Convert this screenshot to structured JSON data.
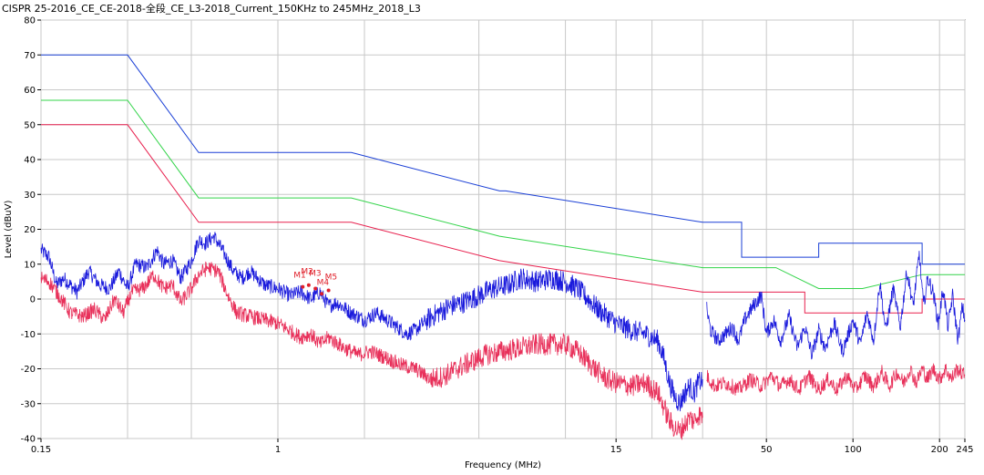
{
  "title": "CISPR 25-2016_CE_CE-2018-全段_CE_L3-2018_Current_150KHz to 245MHz_2018_L3",
  "chart_data": {
    "type": "line",
    "title": "CISPR 25-2016_CE_CE-2018-全段_CE_L3-2018_Current_150KHz to 245MHz_2018_L3",
    "xlabel": "Frequency (MHz)",
    "ylabel": "Level (dBuV)",
    "xscale": "log",
    "xlim": [
      0.15,
      245
    ],
    "ylim": [
      -40,
      80
    ],
    "grid": true,
    "x_ticks": [
      {
        "value": 0.15,
        "label": "0.15"
      },
      {
        "value": 1,
        "label": "1"
      },
      {
        "value": 15,
        "label": "15"
      },
      {
        "value": 50,
        "label": "50"
      },
      {
        "value": 100,
        "label": "100"
      },
      {
        "value": 200,
        "label": "200"
      },
      {
        "value": 245,
        "label": "245"
      }
    ],
    "x_grid": [
      0.15,
      0.3,
      0.5,
      1,
      2,
      5,
      10,
      15,
      20,
      30,
      50,
      100,
      200,
      245
    ],
    "y_ticks": [
      -40,
      -30,
      -20,
      -10,
      0,
      10,
      20,
      30,
      40,
      50,
      60,
      70,
      80
    ],
    "series": [
      {
        "kind": "limit",
        "color": "#1a3fd6",
        "points": [
          [
            0.15,
            70
          ],
          [
            0.3,
            70
          ],
          [
            0.53,
            42
          ],
          [
            1.8,
            42
          ],
          [
            5.9,
            31
          ],
          [
            6.2,
            31
          ],
          [
            30,
            22
          ],
          [
            41,
            22
          ],
          [
            41,
            12
          ],
          [
            54,
            12
          ],
          [
            54,
            12
          ],
          [
            76,
            12
          ],
          [
            76,
            16
          ],
          [
            174,
            16
          ],
          [
            174,
            10
          ],
          [
            245,
            10
          ]
        ]
      },
      {
        "kind": "limit",
        "color": "#33d44a",
        "points": [
          [
            0.15,
            57
          ],
          [
            0.3,
            57
          ],
          [
            0.53,
            29
          ],
          [
            1.8,
            29
          ],
          [
            5.9,
            18
          ],
          [
            30,
            9
          ],
          [
            54,
            9
          ],
          [
            76,
            3
          ],
          [
            108,
            3
          ],
          [
            174,
            7
          ],
          [
            174,
            7
          ],
          [
            245,
            7
          ]
        ]
      },
      {
        "kind": "limit",
        "color": "#e8204e",
        "points": [
          [
            0.15,
            50
          ],
          [
            0.3,
            50
          ],
          [
            0.53,
            22
          ],
          [
            1.8,
            22
          ],
          [
            5.9,
            11
          ],
          [
            30,
            2
          ],
          [
            68,
            2
          ],
          [
            68,
            -4
          ],
          [
            174,
            -4
          ],
          [
            174,
            0
          ],
          [
            245,
            0
          ]
        ]
      },
      {
        "kind": "measurement",
        "color": "#1a1adc",
        "points": [
          [
            0.15,
            14
          ],
          [
            0.16,
            12
          ],
          [
            0.17,
            4
          ],
          [
            0.18,
            6
          ],
          [
            0.2,
            2
          ],
          [
            0.22,
            8
          ],
          [
            0.24,
            4
          ],
          [
            0.26,
            3
          ],
          [
            0.28,
            8
          ],
          [
            0.3,
            3
          ],
          [
            0.32,
            10
          ],
          [
            0.35,
            9
          ],
          [
            0.38,
            14
          ],
          [
            0.4,
            10
          ],
          [
            0.43,
            11
          ],
          [
            0.46,
            6
          ],
          [
            0.5,
            11
          ],
          [
            0.53,
            17
          ],
          [
            0.56,
            16
          ],
          [
            0.6,
            18
          ],
          [
            0.65,
            13
          ],
          [
            0.7,
            8
          ],
          [
            0.75,
            6
          ],
          [
            0.8,
            8
          ],
          [
            0.9,
            4
          ],
          [
            1.0,
            3
          ],
          [
            1.1,
            1
          ],
          [
            1.2,
            2
          ],
          [
            1.3,
            0
          ],
          [
            1.4,
            2
          ],
          [
            1.5,
            -2
          ],
          [
            1.6,
            -1
          ],
          [
            1.8,
            -4
          ],
          [
            2.0,
            -6
          ],
          [
            2.2,
            -4
          ],
          [
            2.5,
            -7
          ],
          [
            2.8,
            -10
          ],
          [
            3.0,
            -9
          ],
          [
            3.3,
            -6
          ],
          [
            3.6,
            -4
          ],
          [
            4.0,
            -2
          ],
          [
            4.4,
            -1
          ],
          [
            5.0,
            1
          ],
          [
            5.6,
            3
          ],
          [
            6.3,
            4
          ],
          [
            7.0,
            6
          ],
          [
            8.0,
            5
          ],
          [
            9.0,
            6
          ],
          [
            10.0,
            5
          ],
          [
            11.0,
            3
          ],
          [
            12.0,
            0
          ],
          [
            13.0,
            -3
          ],
          [
            14.0,
            -5
          ],
          [
            15.0,
            -7
          ],
          [
            17.0,
            -9
          ],
          [
            19.0,
            -10
          ],
          [
            21.0,
            -12
          ],
          [
            22.0,
            -17
          ],
          [
            23.0,
            -24
          ],
          [
            24.0,
            -28
          ],
          [
            25.0,
            -30
          ],
          [
            26.0,
            -27
          ],
          [
            27.0,
            -25
          ],
          [
            28.0,
            -27
          ],
          [
            29.0,
            -24
          ],
          [
            30.0,
            -23
          ]
        ]
      },
      {
        "kind": "measurement",
        "color": "#1a1adc",
        "points": [
          [
            31,
            -3
          ],
          [
            32,
            -9
          ],
          [
            34,
            -12
          ],
          [
            36,
            -10
          ],
          [
            38,
            -8
          ],
          [
            40,
            -12
          ],
          [
            42,
            -6
          ],
          [
            45,
            -2
          ],
          [
            48,
            1
          ],
          [
            50,
            -10
          ],
          [
            53,
            -6
          ],
          [
            56,
            -12
          ],
          [
            60,
            -5
          ],
          [
            64,
            -14
          ],
          [
            68,
            -8
          ],
          [
            72,
            -16
          ],
          [
            76,
            -9
          ],
          [
            80,
            -14
          ],
          [
            86,
            -7
          ],
          [
            92,
            -15
          ],
          [
            100,
            -6
          ],
          [
            106,
            -13
          ],
          [
            112,
            -4
          ],
          [
            118,
            -12
          ],
          [
            124,
            5
          ],
          [
            130,
            -9
          ],
          [
            138,
            3
          ],
          [
            146,
            -8
          ],
          [
            154,
            8
          ],
          [
            162,
            -2
          ],
          [
            170,
            13
          ],
          [
            176,
            -2
          ],
          [
            182,
            6
          ],
          [
            190,
            2
          ],
          [
            198,
            -7
          ],
          [
            206,
            3
          ],
          [
            214,
            -8
          ],
          [
            222,
            1
          ],
          [
            232,
            -12
          ],
          [
            240,
            -2
          ],
          [
            245,
            -6
          ]
        ]
      },
      {
        "kind": "measurement",
        "color": "#e8305a",
        "points": [
          [
            0.15,
            6
          ],
          [
            0.16,
            5
          ],
          [
            0.17,
            2
          ],
          [
            0.19,
            -4
          ],
          [
            0.21,
            -5
          ],
          [
            0.23,
            -3
          ],
          [
            0.25,
            -6
          ],
          [
            0.27,
            0
          ],
          [
            0.29,
            -4
          ],
          [
            0.31,
            2
          ],
          [
            0.34,
            3
          ],
          [
            0.37,
            7
          ],
          [
            0.4,
            3
          ],
          [
            0.43,
            4
          ],
          [
            0.46,
            -1
          ],
          [
            0.5,
            3
          ],
          [
            0.53,
            7
          ],
          [
            0.57,
            9
          ],
          [
            0.62,
            8
          ],
          [
            0.67,
            1
          ],
          [
            0.72,
            -4
          ],
          [
            0.8,
            -5
          ],
          [
            0.9,
            -6
          ],
          [
            1.0,
            -7
          ],
          [
            1.1,
            -9
          ],
          [
            1.2,
            -11
          ],
          [
            1.3,
            -10
          ],
          [
            1.4,
            -13
          ],
          [
            1.5,
            -11
          ],
          [
            1.7,
            -14
          ],
          [
            1.9,
            -16
          ],
          [
            2.1,
            -15
          ],
          [
            2.4,
            -17
          ],
          [
            2.7,
            -19
          ],
          [
            3.0,
            -20
          ],
          [
            3.4,
            -23
          ],
          [
            3.8,
            -22
          ],
          [
            4.2,
            -20
          ],
          [
            4.7,
            -18
          ],
          [
            5.3,
            -16
          ],
          [
            6.0,
            -15
          ],
          [
            7.0,
            -14
          ],
          [
            8.0,
            -13
          ],
          [
            9.0,
            -13
          ],
          [
            10.0,
            -13
          ],
          [
            11.0,
            -15
          ],
          [
            12.0,
            -18
          ],
          [
            13.0,
            -21
          ],
          [
            14.0,
            -23
          ],
          [
            15.0,
            -24
          ],
          [
            17.0,
            -25
          ],
          [
            19.0,
            -24
          ],
          [
            21.0,
            -27
          ],
          [
            22.0,
            -31
          ],
          [
            23.0,
            -35
          ],
          [
            24.0,
            -37
          ],
          [
            25.0,
            -38
          ],
          [
            26.0,
            -36
          ],
          [
            27.0,
            -34
          ],
          [
            28.0,
            -35
          ],
          [
            29.0,
            -33
          ],
          [
            30.0,
            -34
          ]
        ]
      },
      {
        "kind": "measurement",
        "color": "#e8305a",
        "points": [
          [
            31,
            -22
          ],
          [
            33,
            -25
          ],
          [
            36,
            -24
          ],
          [
            40,
            -26
          ],
          [
            44,
            -23
          ],
          [
            48,
            -25
          ],
          [
            52,
            -22
          ],
          [
            56,
            -25
          ],
          [
            60,
            -23
          ],
          [
            65,
            -26
          ],
          [
            70,
            -22
          ],
          [
            76,
            -26
          ],
          [
            82,
            -23
          ],
          [
            88,
            -26
          ],
          [
            95,
            -22
          ],
          [
            102,
            -26
          ],
          [
            110,
            -22
          ],
          [
            118,
            -25
          ],
          [
            126,
            -21
          ],
          [
            134,
            -25
          ],
          [
            142,
            -21
          ],
          [
            150,
            -24
          ],
          [
            158,
            -20
          ],
          [
            166,
            -24
          ],
          [
            174,
            -20
          ],
          [
            182,
            -23
          ],
          [
            190,
            -20
          ],
          [
            200,
            -23
          ],
          [
            210,
            -20
          ],
          [
            220,
            -23
          ],
          [
            230,
            -20
          ],
          [
            245,
            -22
          ]
        ]
      }
    ],
    "markers": [
      {
        "label": "M1",
        "x": 1.22,
        "y": 3.5
      },
      {
        "label": "M2",
        "x": 1.28,
        "y": 4.0
      },
      {
        "label": "M3",
        "x": 1.35,
        "y": 3.0
      },
      {
        "label": "M4",
        "x": 1.42,
        "y": 1.5
      },
      {
        "label": "M5",
        "x": 1.5,
        "y": 2.5
      }
    ]
  }
}
